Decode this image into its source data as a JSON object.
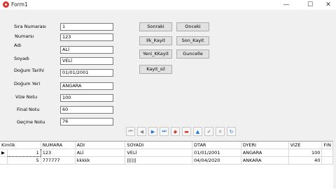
{
  "window": {
    "title": "Form1",
    "minimize": "—",
    "maximize": "☐",
    "close": "✕"
  },
  "form": {
    "fields": [
      {
        "label": "Sıra Numarası",
        "value": "1"
      },
      {
        "label": "Numarsı",
        "value": "123"
      },
      {
        "label": "Adı",
        "value": "ALİ"
      },
      {
        "label": "Soyadı",
        "value": "VELİ"
      },
      {
        "label": "Doğum Tarihi",
        "value": "01/01/2001"
      },
      {
        "label": "Doğum Yeri",
        "value": "ANGARA"
      },
      {
        "label": "Vize Notu",
        "value": "100"
      },
      {
        "label": "Final Notu",
        "value": "60"
      },
      {
        "label": "Geçme Notu",
        "value": "76"
      }
    ]
  },
  "buttons": {
    "sonraki": "Sonraki",
    "onceki": "Onceki",
    "ilk": "Ilk_Kayit",
    "son": "Son_Kayit",
    "yeni": "Yeni_KKayit",
    "guncelle": "Guncelle",
    "sil": "Kayit_sil"
  },
  "navigator": [
    "first-icon",
    "prior-icon",
    "next-icon",
    "last-icon",
    "insert-icon",
    "delete-icon",
    "edit-icon",
    "post-icon",
    "cancel-icon",
    "refresh-icon"
  ],
  "navigator_glyphs": [
    "⏮",
    "◀",
    "▶",
    "⏭",
    "◆",
    "▬",
    "▲",
    "✔",
    "✕",
    "↻"
  ],
  "grid": {
    "columns": [
      "Kimlik",
      "NUMARA",
      "ADI",
      "SOYADI",
      "DTAR",
      "DYERI",
      "VIZE",
      "FIN"
    ],
    "rows": [
      {
        "indicator": "▶",
        "cells": [
          "1",
          "123",
          "ALİ",
          "VELİ",
          "01/01/2001",
          "ANGARA",
          "100",
          ""
        ]
      },
      {
        "indicator": "",
        "cells": [
          "5",
          "777777",
          "kkkkk",
          "||||||",
          "04/04/2020",
          "ANKARA",
          "40",
          ""
        ]
      }
    ]
  },
  "colors": {
    "window_bg": "#f0f0f0",
    "button_bg": "#e1e1e1",
    "nav_blue": "#1e78d2",
    "nav_red": "#e0392b"
  }
}
